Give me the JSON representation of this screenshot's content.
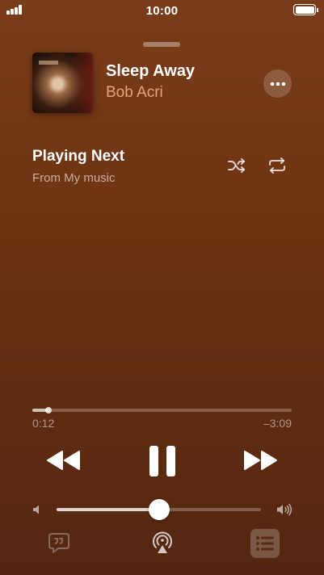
{
  "status_bar": {
    "time": "10:00",
    "battery_level": 1.0,
    "signal_bars": 4
  },
  "now_playing": {
    "title": "Sleep Away",
    "artist": "Bob Acri"
  },
  "queue": {
    "heading": "Playing Next",
    "source": "From My music"
  },
  "playback": {
    "elapsed": "0:12",
    "remaining": "–3:09",
    "progress_fraction": 0.063,
    "state": "playing"
  },
  "volume": {
    "level_fraction": 0.5
  },
  "icons": {
    "more": "ellipsis-icon",
    "shuffle": "shuffle-icon",
    "repeat": "repeat-icon",
    "rewind": "rewind-icon",
    "pause": "pause-icon",
    "forward": "fast-forward-icon",
    "volume_low": "speaker-low-icon",
    "volume_high": "speaker-high-icon",
    "lyrics": "lyrics-icon",
    "airplay": "airplay-icon",
    "queue": "queue-list-icon"
  },
  "colors": {
    "background_top": "#7a3d1a",
    "background_bottom": "#542711",
    "artist_text": "#e8a880"
  }
}
